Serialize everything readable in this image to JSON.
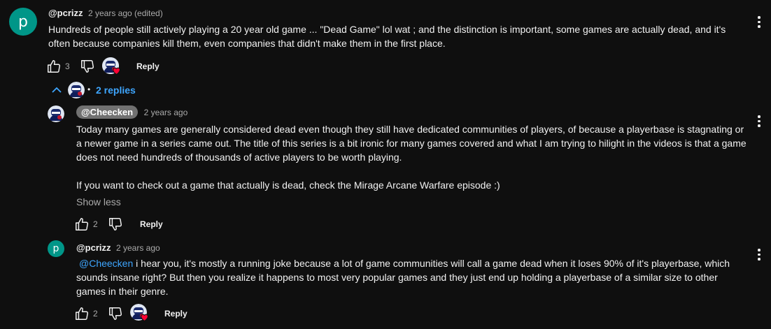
{
  "thread": {
    "comment": {
      "avatar_letter": "p",
      "avatar_color": "#009688",
      "handle": "@pcrizz",
      "meta": "2 years ago (edited)",
      "text": "Hundreds of people still actively playing a 20 year old game  ... \"Dead Game\"  lol wat  ; and the distinction is important, some games are actually dead, and it's often because companies kill them, even companies that didn't make them in the first place.",
      "like_count": "3",
      "reply_label": "Reply"
    },
    "replies_toggle": {
      "label": "2 replies",
      "separator": "•"
    },
    "replies": [
      {
        "handle": "@Cheecken",
        "meta": "2 years ago",
        "paragraph1": "Today many games are generally considered dead even though they still have dedicated communities of players, of because a playerbase is stagnating or a newer game in a series came out. The title of this series is a bit ironic for many games covered and what I am trying to hilight in the videos is that a game does not need hundreds of thousands of active players to be worth playing.",
        "paragraph2": "If you want to check out a game that actually is dead, check the Mirage Arcane Warfare episode :)",
        "show_less": "Show less",
        "like_count": "2",
        "reply_label": "Reply"
      },
      {
        "avatar_letter": "p",
        "handle": "@pcrizz",
        "meta": "2 years ago",
        "mention": "@Cheecken",
        "text": " i hear you, it's mostly a running joke because a lot of game communities will call a game dead when it loses 90% of it's playerbase, which sounds insane right?  But then you realize it happens to most very popular games and they just end up holding a playerbase of a similar size to other games in their genre.",
        "like_count": "2",
        "reply_label": "Reply"
      }
    ]
  },
  "colors": {
    "background": "#0f0f0f",
    "text": "#f1f1f1",
    "secondary": "#aaaaaa",
    "link": "#3ea6ff",
    "creator_pill": "#717171",
    "heart": "#ff0033"
  },
  "icons": [
    "thumbs-up-icon",
    "thumbs-down-icon",
    "creator-heart-icon",
    "chevron-up-icon",
    "more-vert-icon"
  ]
}
